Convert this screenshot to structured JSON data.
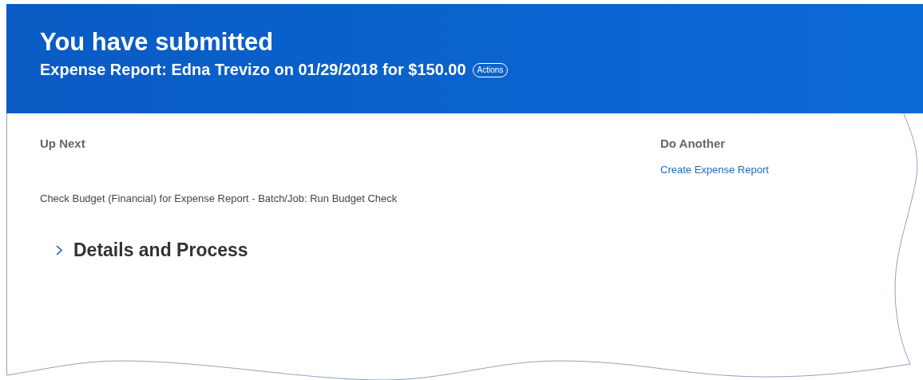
{
  "header": {
    "title": "You have submitted",
    "subtitle": "Expense Report: Edna Trevizo on 01/29/2018 for $150.00",
    "actions_button": "Actions"
  },
  "up_next": {
    "heading": "Up Next",
    "task": "Check Budget (Financial) for Expense Report - Batch/Job: Run Budget Check"
  },
  "details_section": {
    "title": "Details and Process",
    "expanded": false
  },
  "do_another": {
    "heading": "Do Another",
    "links": [
      "Create Expense Report"
    ]
  }
}
